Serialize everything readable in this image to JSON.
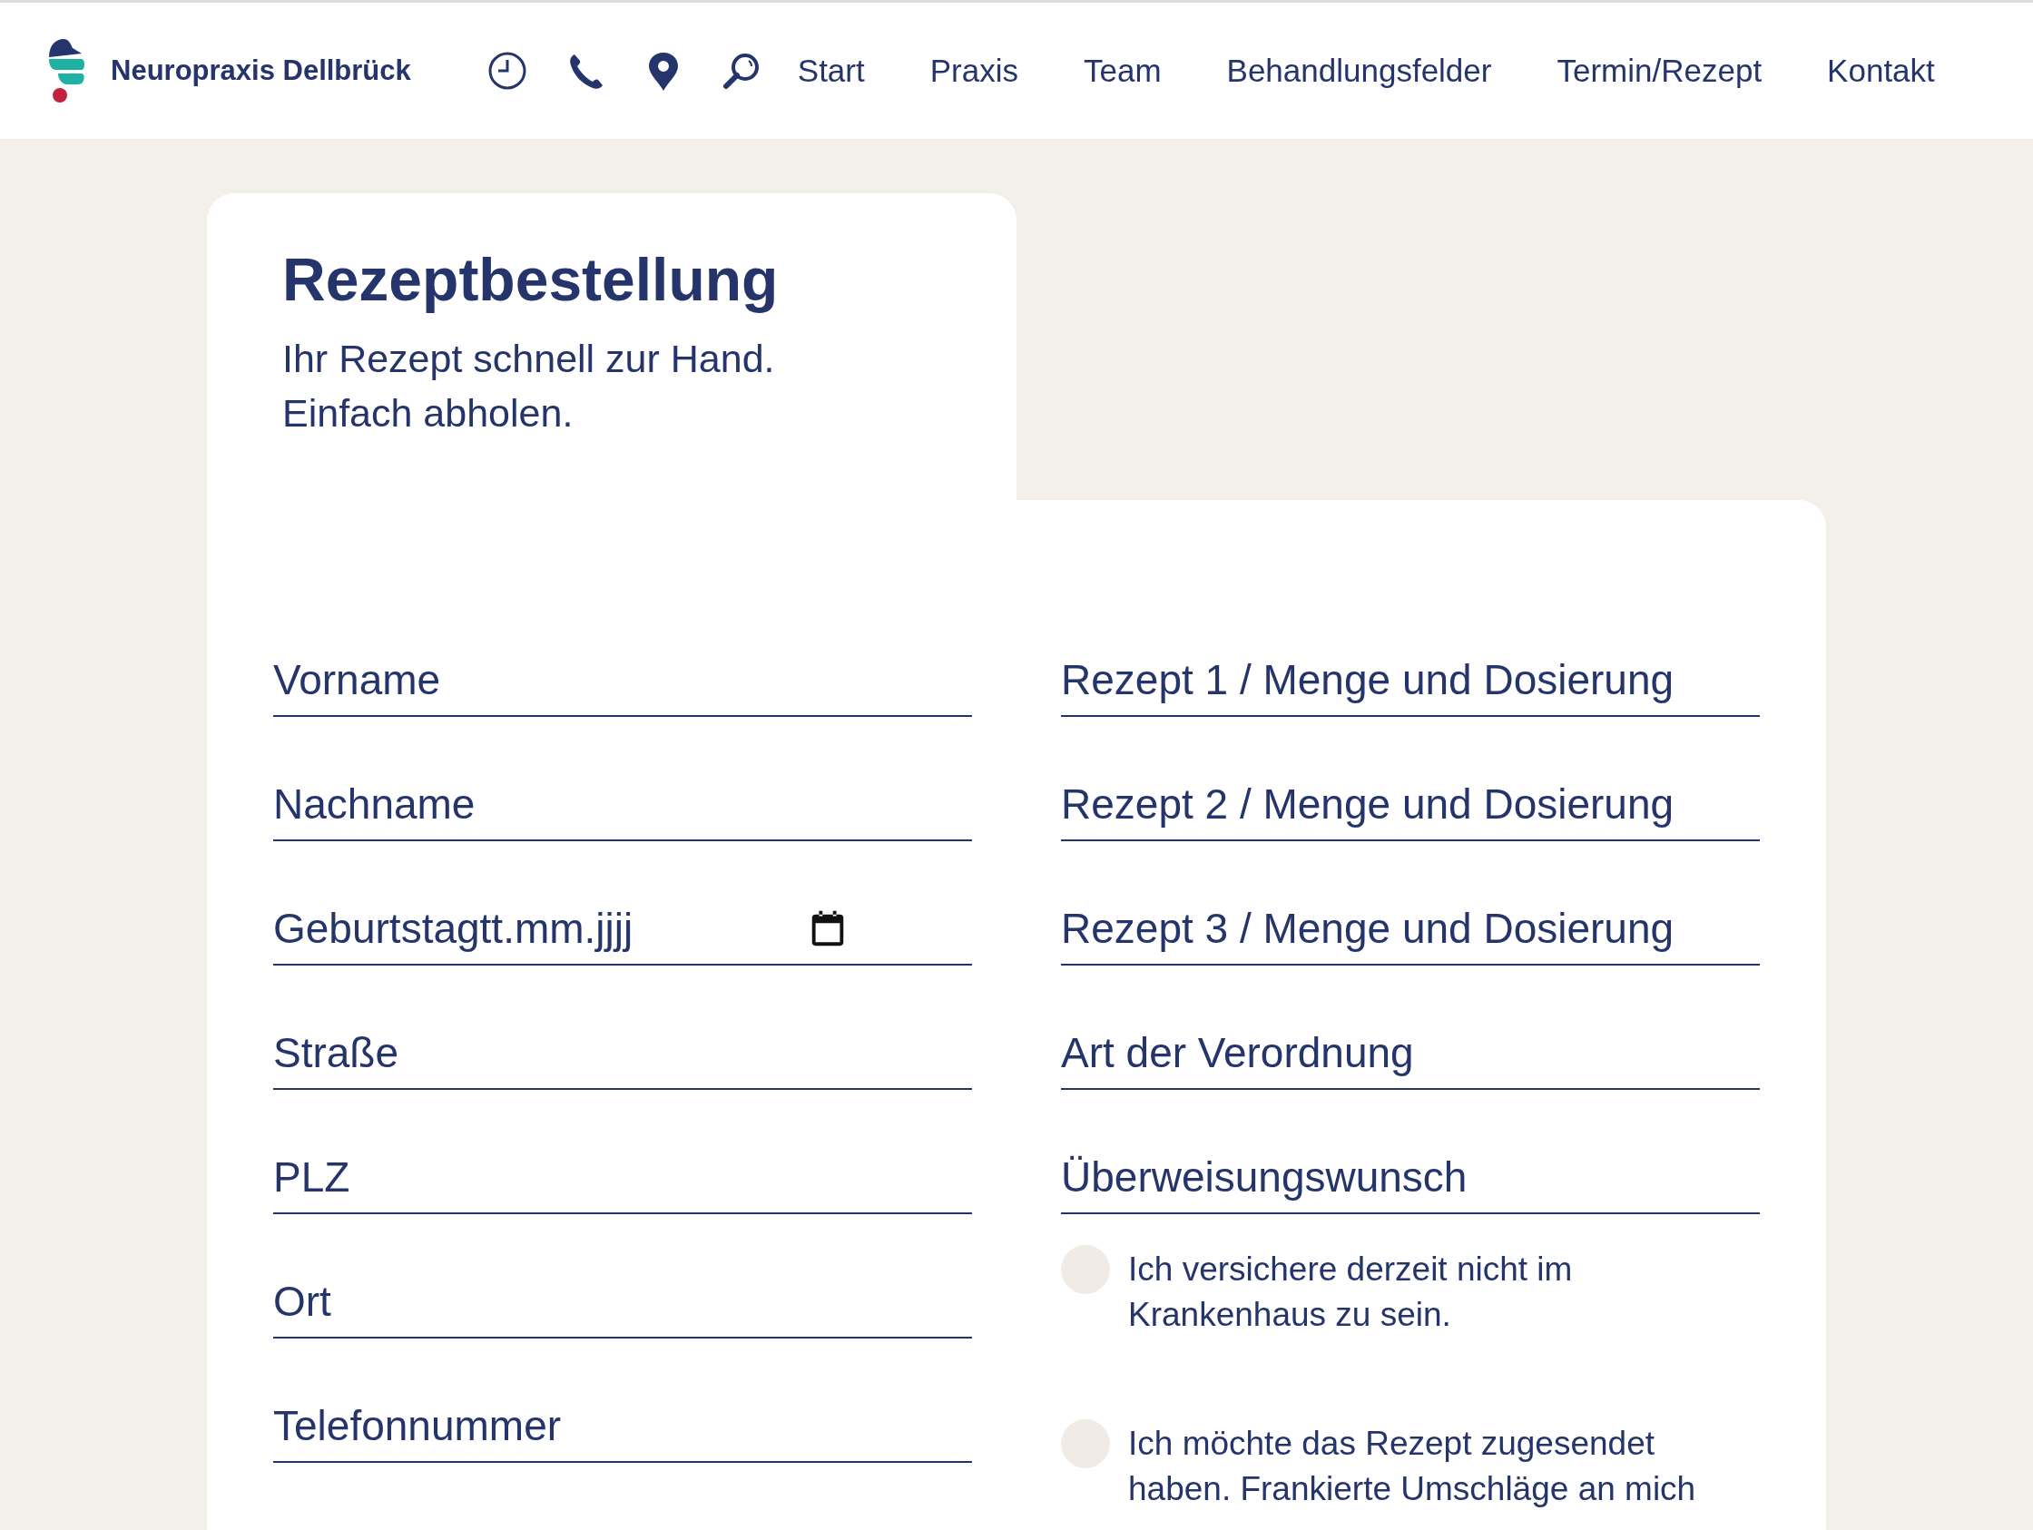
{
  "header": {
    "brand": "Neuropraxis Dellbrück",
    "icons": [
      {
        "kind": "clock"
      },
      {
        "kind": "phone"
      },
      {
        "kind": "pin"
      },
      {
        "kind": "search"
      }
    ],
    "nav": [
      {
        "label": "Start"
      },
      {
        "label": "Praxis"
      },
      {
        "label": "Team"
      },
      {
        "label": "Behandlungsfelder"
      },
      {
        "label": "Termin/Rezept"
      },
      {
        "label": "Kontakt"
      }
    ]
  },
  "intro": {
    "title": "Rezeptbestellung",
    "lines": [
      "Ihr Rezept schnell zur Hand.",
      "Einfach abholen."
    ]
  },
  "left_fields": [
    {
      "kind": "text",
      "placeholder": "Vorname"
    },
    {
      "kind": "text",
      "placeholder": "Nachname"
    },
    {
      "kind": "date",
      "label": "Geburtstag",
      "placeholder": "tt.mm.jjjj"
    },
    {
      "kind": "text",
      "placeholder": "Straße"
    },
    {
      "kind": "text",
      "placeholder": "PLZ"
    },
    {
      "kind": "text",
      "placeholder": "Ort"
    },
    {
      "kind": "text",
      "placeholder": "Telefonnummer"
    }
  ],
  "right_fields": [
    {
      "kind": "text",
      "placeholder": "Rezept 1 / Menge und Dosierung"
    },
    {
      "kind": "text",
      "placeholder": "Rezept 2 / Menge und Dosierung"
    },
    {
      "kind": "text",
      "placeholder": "Rezept 3 / Menge und Dosierung"
    },
    {
      "kind": "text",
      "placeholder": "Art der Verordnung"
    },
    {
      "kind": "text",
      "placeholder": "Überweisungswunsch"
    }
  ],
  "checkboxes": [
    {
      "label": "Ich versichere derzeit nicht im Krankenhaus zu sein.",
      "checked": false
    },
    {
      "label": "Ich möchte das Rezept zugesendet haben. Frankierte Umschläge an mich",
      "checked": false
    }
  ]
}
